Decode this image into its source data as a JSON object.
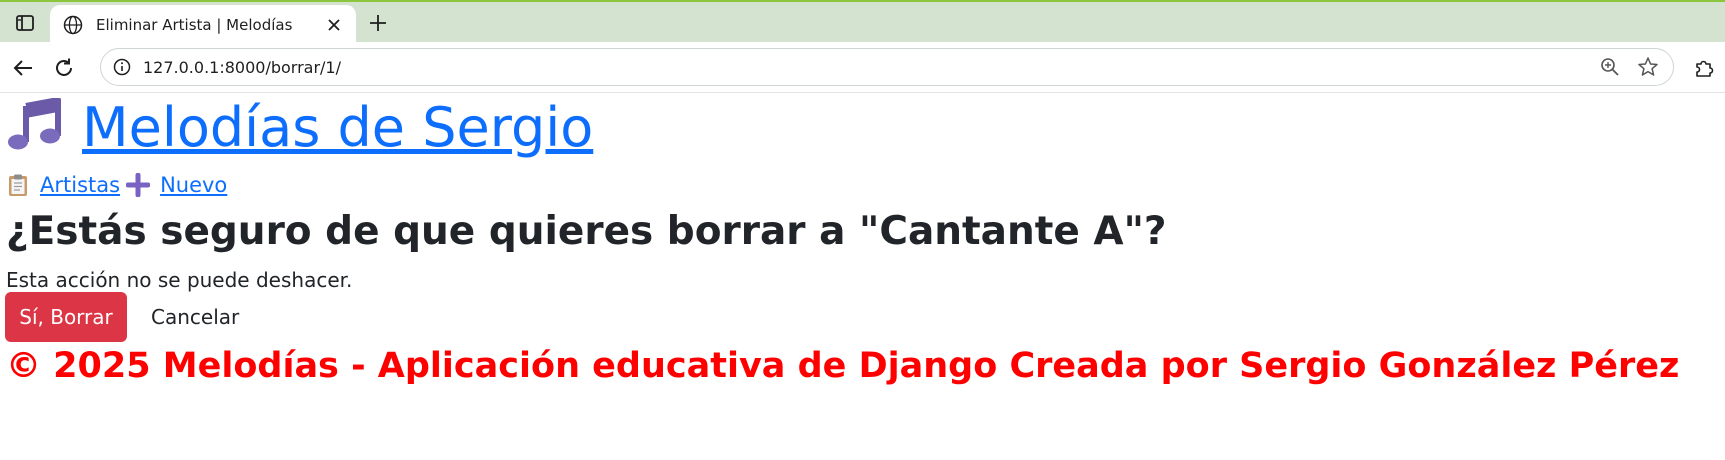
{
  "browser": {
    "tab_title": "Eliminar Artista | Melodías",
    "url": "127.0.0.1:8000/borrar/1/"
  },
  "site": {
    "title": "Melodías de Sergio",
    "title_icon": "musical-notes-icon"
  },
  "nav": {
    "items": [
      {
        "label": "Artistas",
        "icon": "clipboard-icon"
      },
      {
        "label": "Nuevo",
        "icon": "plus-icon"
      }
    ]
  },
  "main": {
    "heading": "¿Estás seguro de que quieres borrar a \"Cantante A\"?",
    "warning": "Esta acción no se puede deshacer.",
    "confirm_label": "Sí, Borrar",
    "cancel_label": "Cancelar"
  },
  "footer": {
    "text": "© 2025 Melodías - Aplicación educativa de Django Creada por Sergio González Pérez"
  },
  "colors": {
    "link": "#0d6efd",
    "danger": "#dc3545",
    "footer": "#ff0000",
    "tabbar": "#d3e3d0"
  }
}
